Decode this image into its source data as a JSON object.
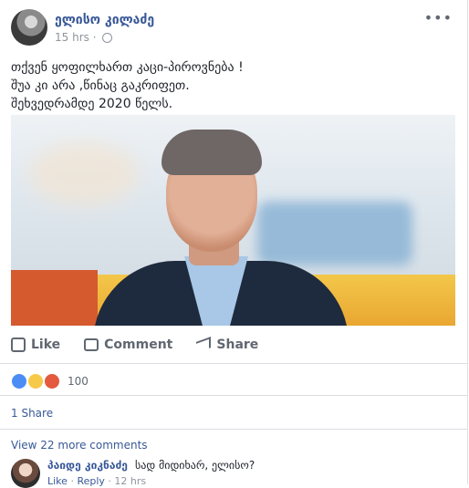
{
  "post": {
    "author": "ელისო კილაძე",
    "time": "15 hrs ·",
    "text_lines": [
      "თქვენ ყოფილხართ კაცი-პიროვნება !",
      "შუა კი არა ,წინაც გაკრიფეთ.",
      "შეხვედრამდე 2020 წელს."
    ],
    "more_label": "•••"
  },
  "actions": {
    "like": "Like",
    "comment": "Comment",
    "share": "Share"
  },
  "stats": {
    "reactions_count": "100",
    "shares": "1 Share",
    "view_more": "View 22 more comments"
  },
  "comment": {
    "author": "პაიდე კიკნაძე",
    "text": "სად მიდიხარ, ელისო?",
    "like": "Like",
    "reply": "Reply",
    "time": "12 hrs"
  },
  "colors": {
    "link_blue": "#385898",
    "secondary_text": "#606770",
    "meta_gray": "#90949c"
  }
}
